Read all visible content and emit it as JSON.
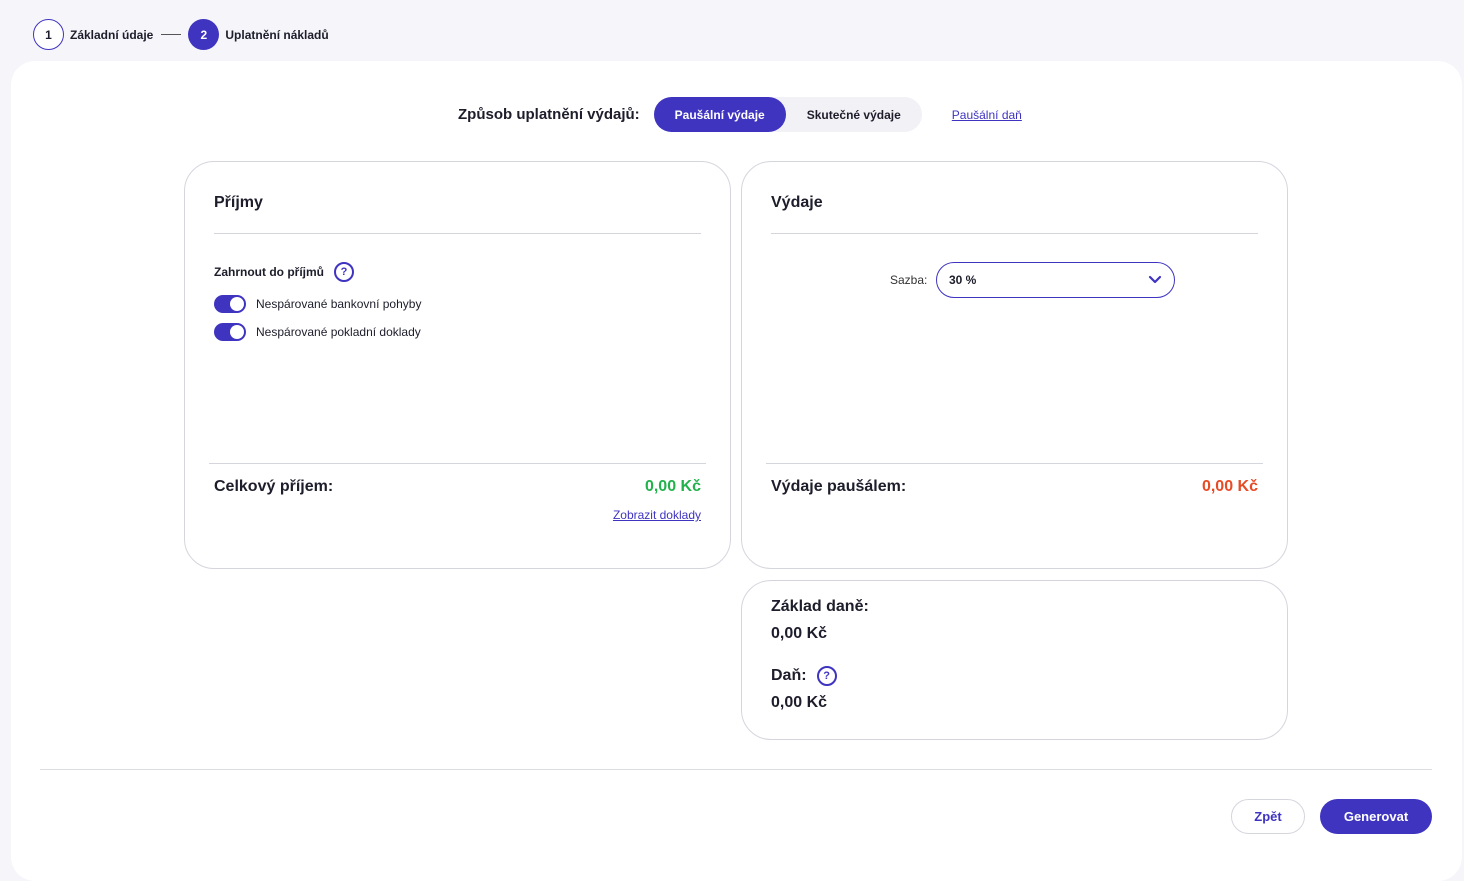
{
  "stepper": {
    "steps": [
      {
        "number": "1",
        "label": "Základní údaje"
      },
      {
        "number": "2",
        "label": "Uplatnění nákladů"
      }
    ]
  },
  "method": {
    "label": "Způsob uplatnění výdajů:",
    "options": [
      "Paušální výdaje",
      "Skutečné výdaje"
    ],
    "selected": "Paušální výdaje",
    "link": "Paušální daň"
  },
  "income": {
    "title": "Příjmy",
    "include_label": "Zahrnout do příjmů",
    "help": "?",
    "toggles": [
      {
        "label": "Nespárované bankovní pohyby",
        "on": true
      },
      {
        "label": "Nespárované pokladní doklady",
        "on": true
      }
    ],
    "total_label": "Celkový příjem:",
    "total_value": "0,00 Kč",
    "show_docs_link": "Zobrazit doklady"
  },
  "expenses": {
    "title": "Výdaje",
    "rate_label": "Sazba:",
    "rate_value": "30 %",
    "total_label": "Výdaje paušálem:",
    "total_value": "0,00 Kč"
  },
  "tax": {
    "base_label": "Základ daně:",
    "base_value": "0,00 Kč",
    "tax_label": "Daň:",
    "tax_help": "?",
    "tax_value": "0,00 Kč"
  },
  "footer": {
    "back_label": "Zpět",
    "generate_label": "Generovat"
  },
  "colors": {
    "accent": "#3f34c0",
    "positive": "#22b24c",
    "negative": "#e84a25"
  }
}
